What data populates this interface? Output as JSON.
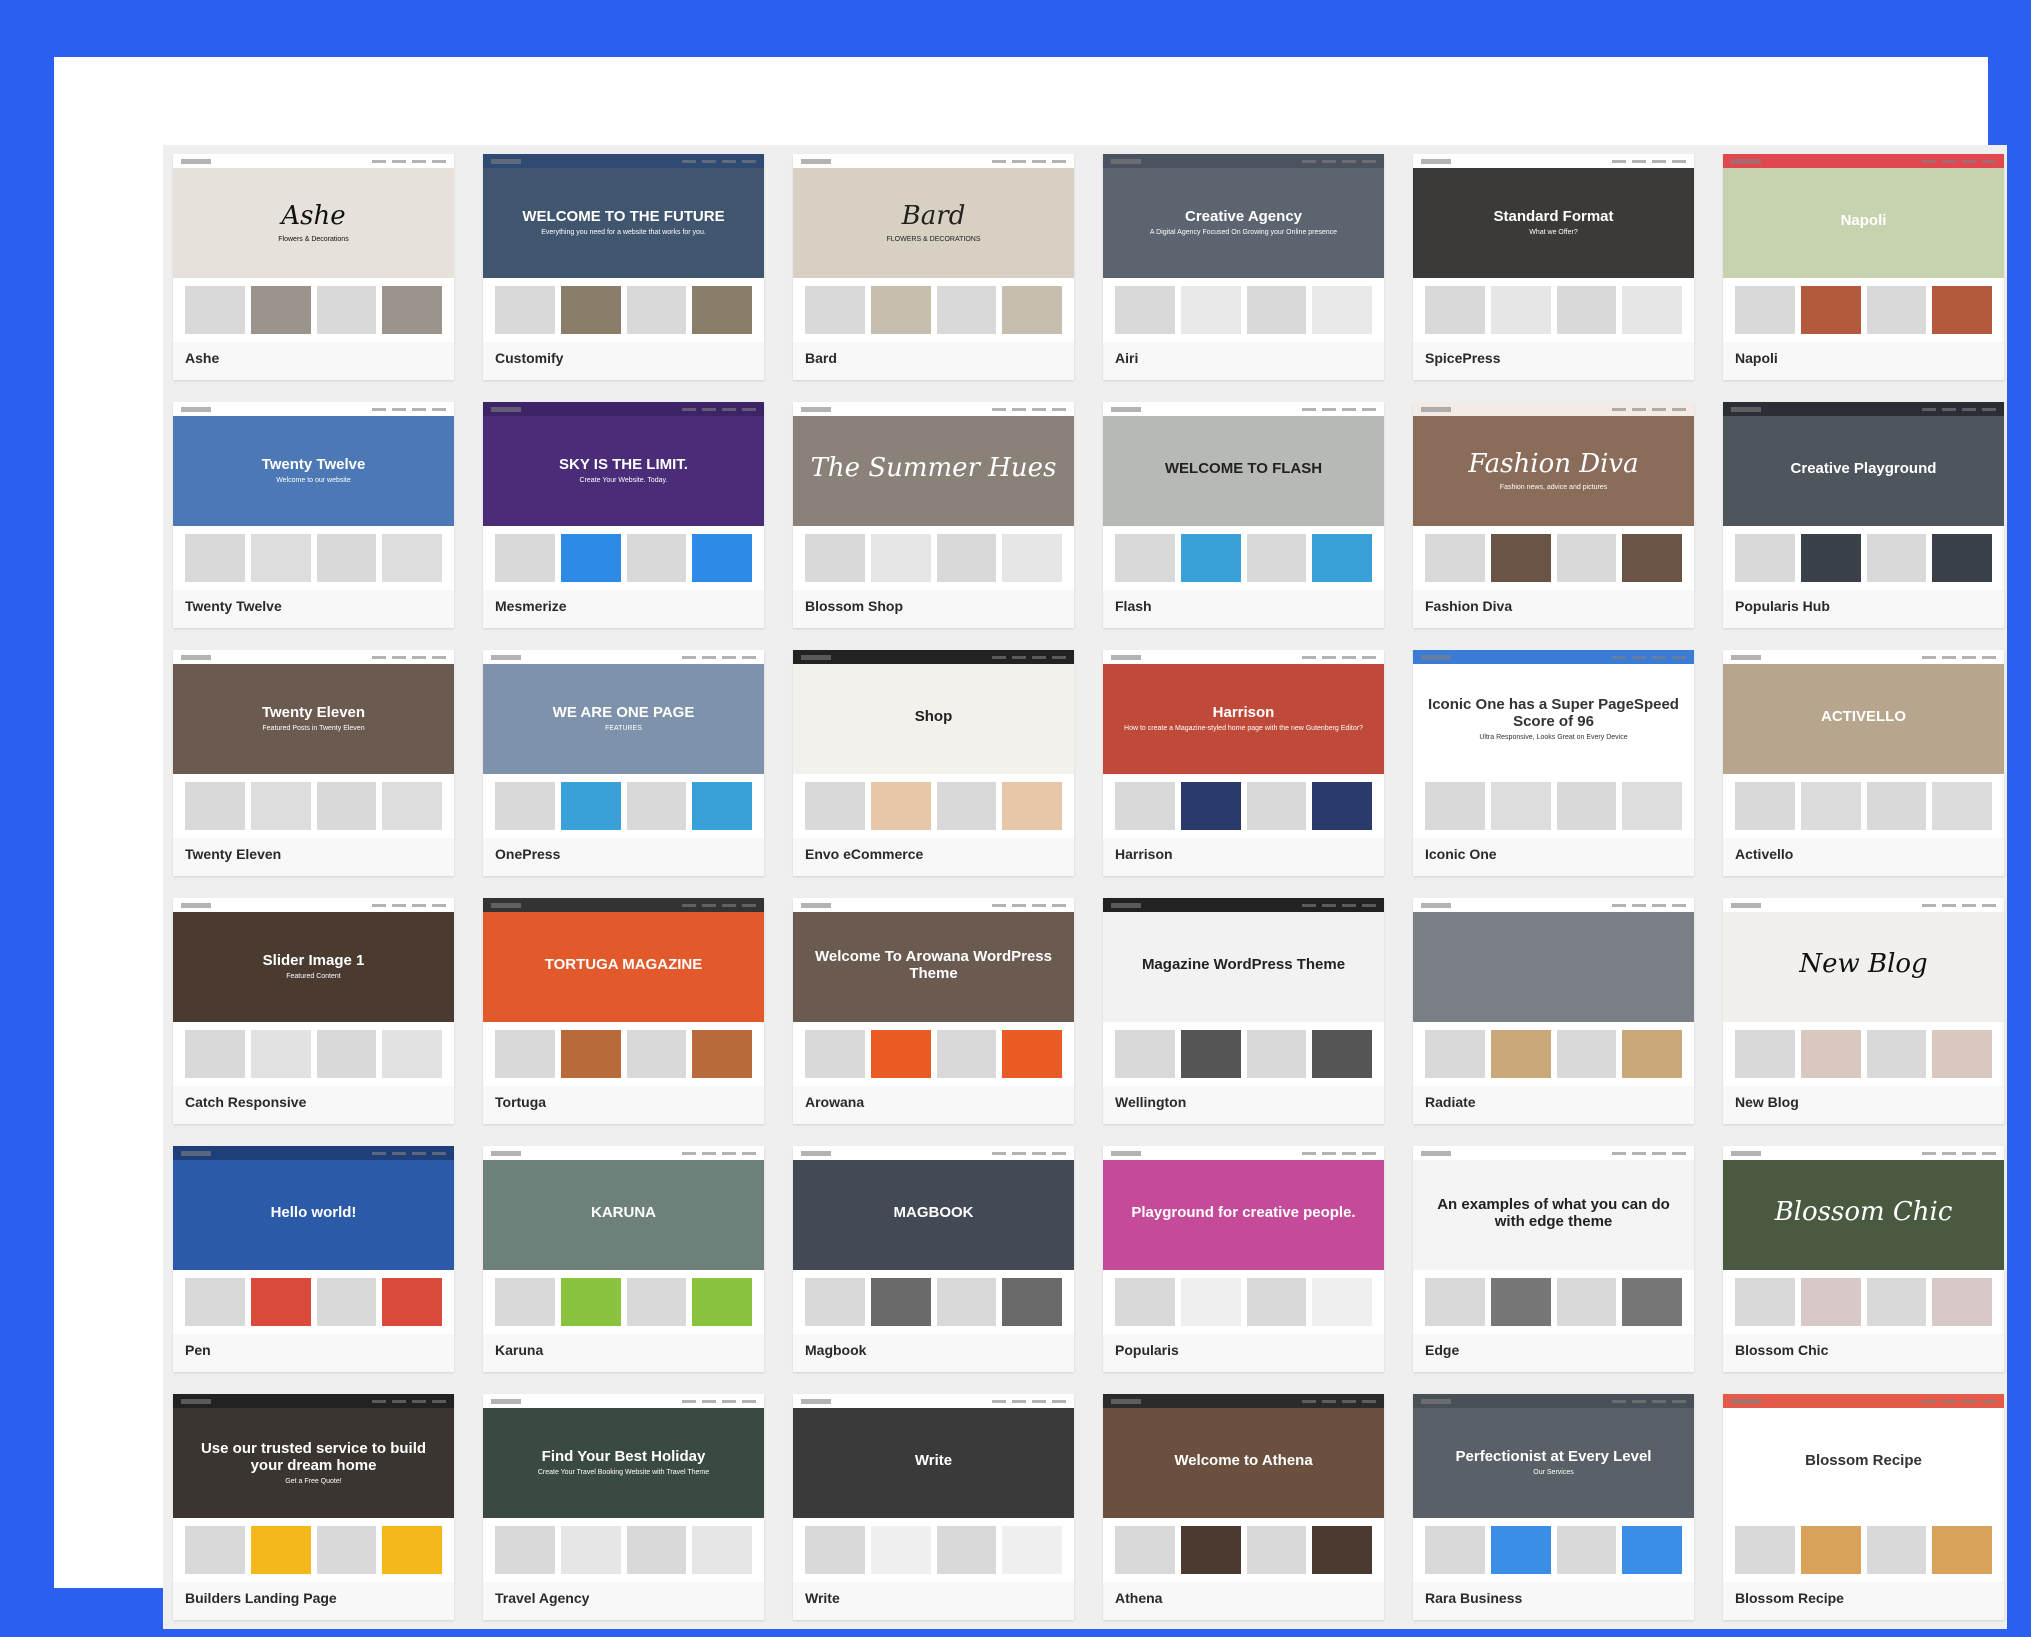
{
  "colors": {
    "background": "#2b5ff0",
    "panel": "#ffffff",
    "gallery": "#efefef"
  },
  "themes": [
    {
      "name": "Ashe",
      "title": "Ashe",
      "subtitle": "Flowers & Decorations",
      "nav": "#ffffff",
      "hero": "#e6e1da",
      "ink": "#111111",
      "block": "#9a948c",
      "script": true
    },
    {
      "name": "Customify",
      "title": "WELCOME TO THE FUTURE",
      "subtitle": "Everything you need for a website that works for you.",
      "nav": "#2f4a73",
      "hero": "#40566f",
      "ink": "#ffffff",
      "block": "#8a7d6a"
    },
    {
      "name": "Bard",
      "title": "Bard",
      "subtitle": "FLOWERS & DECORATIONS",
      "nav": "#ffffff",
      "hero": "#d8d0c2",
      "ink": "#222222",
      "block": "#c7bfae",
      "script": true
    },
    {
      "name": "Airi",
      "title": "Creative Agency",
      "subtitle": "A Digital Agency Focused On Growing your Online presence",
      "nav": "#4b5260",
      "hero": "#5c6470",
      "ink": "#ffffff",
      "block": "#e8e8e8"
    },
    {
      "name": "SpicePress",
      "title": "Standard Format",
      "subtitle": "What we Offer?",
      "nav": "#ffffff",
      "hero": "#3b3a38",
      "ink": "#ffffff",
      "block": "#e6e6e6"
    },
    {
      "name": "Napoli",
      "title": "Napoli",
      "subtitle": "",
      "nav": "#e0484f",
      "hero": "#c7d2ae",
      "ink": "#ffffff",
      "block": "#b45a3c"
    },
    {
      "name": "Twenty Twelve",
      "title": "Twenty Twelve",
      "subtitle": "Welcome to our website",
      "nav": "#ffffff",
      "hero": "#4c79b5",
      "ink": "#ffffff",
      "block": "#dddddd"
    },
    {
      "name": "Mesmerize",
      "title": "SKY IS THE LIMIT.",
      "subtitle": "Create Your Website. Today.",
      "nav": "#3c2466",
      "hero": "#4b2c78",
      "ink": "#ffffff",
      "block": "#2d8ae6"
    },
    {
      "name": "Blossom Shop",
      "title": "The Summer Hues",
      "subtitle": "",
      "nav": "#ffffff",
      "hero": "#8a8178",
      "ink": "#ffffff",
      "block": "#e6e6e6",
      "script": true
    },
    {
      "name": "Flash",
      "title": "WELCOME TO FLASH",
      "subtitle": "",
      "nav": "#ffffff",
      "hero": "#b7b9b5",
      "ink": "#222222",
      "block": "#3aa0d8"
    },
    {
      "name": "Fashion Diva",
      "title": "Fashion Diva",
      "subtitle": "Fashion news, advice and pictures",
      "nav": "#f3ece6",
      "hero": "#8a6c5a",
      "ink": "#ffffff",
      "block": "#6a5446",
      "script": true
    },
    {
      "name": "Popularis Hub",
      "title": "Creative Playground",
      "subtitle": "",
      "nav": "#2b2f35",
      "hero": "#4f555c",
      "ink": "#ffffff",
      "block": "#3b4148"
    },
    {
      "name": "Twenty Eleven",
      "title": "Twenty Eleven",
      "subtitle": "Featured Posts in Twenty Eleven",
      "nav": "#ffffff",
      "hero": "#6b5a50",
      "ink": "#ffffff",
      "block": "#dddddd"
    },
    {
      "name": "OnePress",
      "title": "WE ARE ONE PAGE",
      "subtitle": "FEATURES",
      "nav": "#ffffff",
      "hero": "#7e93ab",
      "ink": "#ffffff",
      "block": "#3aa0d8"
    },
    {
      "name": "Envo eCommerce",
      "title": "Shop",
      "subtitle": "",
      "nav": "#222222",
      "hero": "#f4f1ec",
      "ink": "#222222",
      "block": "#e8c7a8"
    },
    {
      "name": "Harrison",
      "title": "Harrison",
      "subtitle": "How to create a Magazine-styled home page with the new Gutenberg Editor?",
      "nav": "#ffffff",
      "hero": "#c04a3a",
      "ink": "#ffffff",
      "block": "#2a3a6a"
    },
    {
      "name": "Iconic One",
      "title": "Iconic One has a Super PageSpeed Score of 96",
      "subtitle": "Ultra Responsive, Looks Great on Every Device",
      "nav": "#3a7bd5",
      "hero": "#ffffff",
      "ink": "#333333",
      "block": "#dddddd"
    },
    {
      "name": "Activello",
      "title": "ACTIVELLO",
      "subtitle": "",
      "nav": "#ffffff",
      "hero": "#b8a58e",
      "ink": "#ffffff",
      "block": "#dcdcdc"
    },
    {
      "name": "Catch Responsive",
      "title": "Slider Image 1",
      "subtitle": "Featured Content",
      "nav": "#ffffff",
      "hero": "#4a3a30",
      "ink": "#ffffff",
      "block": "#e2e2e2"
    },
    {
      "name": "Tortuga",
      "title": "TORTUGA MAGAZINE",
      "subtitle": "",
      "nav": "#333333",
      "hero": "#e25a2c",
      "ink": "#ffffff",
      "block": "#b86a3a"
    },
    {
      "name": "Arowana",
      "title": "Welcome To Arowana WordPress Theme",
      "subtitle": "",
      "nav": "#ffffff",
      "hero": "#6a5a50",
      "ink": "#ffffff",
      "block": "#e85c24"
    },
    {
      "name": "Wellington",
      "title": "Magazine WordPress Theme",
      "subtitle": "",
      "nav": "#222222",
      "hero": "#f2f2f2",
      "ink": "#222222",
      "block": "#555555"
    },
    {
      "name": "Radiate",
      "title": "",
      "subtitle": "",
      "nav": "#ffffff",
      "hero": "#7a7f85",
      "ink": "#ffffff",
      "block": "#c9a97a"
    },
    {
      "name": "New Blog",
      "title": "New Blog",
      "subtitle": "",
      "nav": "#ffffff",
      "hero": "#f2f0ec",
      "ink": "#111111",
      "block": "#d8c8c0",
      "script": true
    },
    {
      "name": "Pen",
      "title": "Hello world!",
      "subtitle": "",
      "nav": "#1f3f7a",
      "hero": "#2b5aa8",
      "ink": "#ffffff",
      "block": "#d94a3a"
    },
    {
      "name": "Karuna",
      "title": "KARUNA",
      "subtitle": "",
      "nav": "#ffffff",
      "hero": "#6d8079",
      "ink": "#ffffff",
      "block": "#8ac43f"
    },
    {
      "name": "Magbook",
      "title": "MAGBOOK",
      "subtitle": "",
      "nav": "#ffffff",
      "hero": "#444a55",
      "ink": "#ffffff",
      "block": "#6a6a6a"
    },
    {
      "name": "Popularis",
      "title": "Playground for creative people.",
      "subtitle": "",
      "nav": "#ffffff",
      "hero": "#c64a9a",
      "ink": "#ffffff",
      "block": "#efefef"
    },
    {
      "name": "Edge",
      "title": "An examples of what you can do with edge theme",
      "subtitle": "",
      "nav": "#ffffff",
      "hero": "#f4f4f4",
      "ink": "#222222",
      "block": "#777777"
    },
    {
      "name": "Blossom Chic",
      "title": "Blossom Chic",
      "subtitle": "",
      "nav": "#ffffff",
      "hero": "#4a5a40",
      "ink": "#ffffff",
      "block": "#d8c8c8",
      "script": true
    },
    {
      "name": "Builders Landing Page",
      "title": "Use our trusted service to build your dream home",
      "subtitle": "Get a Free Quote!",
      "nav": "#222222",
      "hero": "#3a3530",
      "ink": "#ffffff",
      "block": "#f3b81b"
    },
    {
      "name": "Travel Agency",
      "title": "Find Your Best Holiday",
      "subtitle": "Create Your Travel Booking Website with Travel Theme",
      "nav": "#ffffff",
      "hero": "#3a4a40",
      "ink": "#ffffff",
      "block": "#e6e6e6"
    },
    {
      "name": "Write",
      "title": "Write",
      "subtitle": "",
      "nav": "#ffffff",
      "hero": "#3a3a3a",
      "ink": "#ffffff",
      "block": "#f0f0f0"
    },
    {
      "name": "Athena",
      "title": "Welcome to Athena",
      "subtitle": "",
      "nav": "#2b2b2b",
      "hero": "#6b5040",
      "ink": "#ffffff",
      "block": "#4a3a30"
    },
    {
      "name": "Rara Business",
      "title": "Perfectionist at Every Level",
      "subtitle": "Our Services",
      "nav": "#4a5058",
      "hero": "#5a6068",
      "ink": "#ffffff",
      "block": "#3a8ee6"
    },
    {
      "name": "Blossom Recipe",
      "title": "Blossom Recipe",
      "subtitle": "",
      "nav": "#e35a4a",
      "hero": "#ffffff",
      "ink": "#333333",
      "block": "#d9a25a"
    }
  ]
}
